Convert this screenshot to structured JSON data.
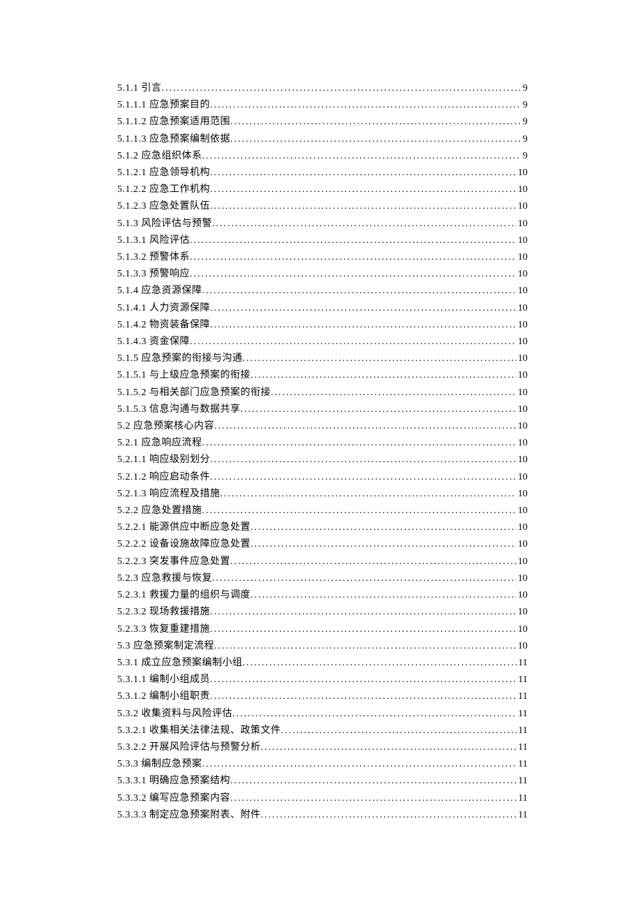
{
  "toc": [
    {
      "num": "5.1.1",
      "title": "引言",
      "page": "9"
    },
    {
      "num": "5.1.1.1",
      "title": "应急预案目的",
      "page": "9"
    },
    {
      "num": "5.1.1.2",
      "title": "应急预案适用范围",
      "page": "9"
    },
    {
      "num": "5.1.1.3",
      "title": "应急预案编制依据",
      "page": "9"
    },
    {
      "num": "5.1.2",
      "title": "应急组织体系",
      "page": "9"
    },
    {
      "num": "5.1.2.1",
      "title": "应急领导机构",
      "page": "10"
    },
    {
      "num": "5.1.2.2",
      "title": "应急工作机构",
      "page": "10"
    },
    {
      "num": "5.1.2.3",
      "title": "应急处置队伍",
      "page": "10"
    },
    {
      "num": "5.1.3",
      "title": "风险评估与预警",
      "page": "10"
    },
    {
      "num": "5.1.3.1",
      "title": "风险评估",
      "page": "10"
    },
    {
      "num": "5.1.3.2",
      "title": "预警体系",
      "page": "10"
    },
    {
      "num": "5.1.3.3",
      "title": "预警响应",
      "page": "10"
    },
    {
      "num": "5.1.4",
      "title": "应急资源保障",
      "page": "10"
    },
    {
      "num": "5.1.4.1",
      "title": "人力资源保障",
      "page": "10"
    },
    {
      "num": "5.1.4.2",
      "title": "物资装备保障",
      "page": "10"
    },
    {
      "num": "5.1.4.3",
      "title": "资金保障",
      "page": "10"
    },
    {
      "num": "5.1.5",
      "title": "应急预案的衔接与沟通",
      "page": "10"
    },
    {
      "num": "5.1.5.1",
      "title": "与上级应急预案的衔接",
      "page": "10"
    },
    {
      "num": "5.1.5.2",
      "title": "与相关部门应急预案的衔接",
      "page": "10"
    },
    {
      "num": "5.1.5.3",
      "title": "信息沟通与数据共享",
      "page": "10"
    },
    {
      "num": "5.2",
      "title": "应急预案核心内容",
      "page": "10"
    },
    {
      "num": "5.2.1",
      "title": "应急响应流程",
      "page": "10"
    },
    {
      "num": "5.2.1.1",
      "title": "响应级别划分",
      "page": "10"
    },
    {
      "num": "5.2.1.2",
      "title": "响应启动条件",
      "page": "10"
    },
    {
      "num": "5.2.1.3",
      "title": "响应流程及措施",
      "page": "10"
    },
    {
      "num": "5.2.2",
      "title": "应急处置措施",
      "page": "10"
    },
    {
      "num": "5.2.2.1",
      "title": "能源供应中断应急处置",
      "page": "10"
    },
    {
      "num": "5.2.2.2",
      "title": "设备设施故障应急处置",
      "page": "10"
    },
    {
      "num": "5.2.2.3",
      "title": "突发事件应急处置",
      "page": "10"
    },
    {
      "num": "5.2.3",
      "title": "应急救援与恢复",
      "page": "10"
    },
    {
      "num": "5.2.3.1",
      "title": "救援力量的组织与调度",
      "page": "10"
    },
    {
      "num": "5.2.3.2",
      "title": "现场救援措施",
      "page": "10"
    },
    {
      "num": "5.2.3.3",
      "title": "恢复重建措施",
      "page": "10"
    },
    {
      "num": "5.3",
      "title": "应急预案制定流程",
      "page": "10"
    },
    {
      "num": "5.3.1",
      "title": "成立应急预案编制小组",
      "page": "11"
    },
    {
      "num": "5.3.1.1",
      "title": "编制小组成员",
      "page": "11"
    },
    {
      "num": "5.3.1.2",
      "title": "编制小组职责",
      "page": "11"
    },
    {
      "num": "5.3.2",
      "title": "收集资料与风险评估",
      "page": "11"
    },
    {
      "num": "5.3.2.1",
      "title": "收集相关法律法规、政策文件",
      "page": "11"
    },
    {
      "num": "5.3.2.2",
      "title": "开展风险评估与预警分析",
      "page": "11"
    },
    {
      "num": "5.3.3",
      "title": "编制应急预案",
      "page": "11"
    },
    {
      "num": "5.3.3.1",
      "title": "明确应急预案结构",
      "page": "11"
    },
    {
      "num": "5.3.3.2",
      "title": "编写应急预案内容",
      "page": "11"
    },
    {
      "num": "5.3.3.3",
      "title": "制定应急预案附表、附件",
      "page": "11"
    }
  ]
}
